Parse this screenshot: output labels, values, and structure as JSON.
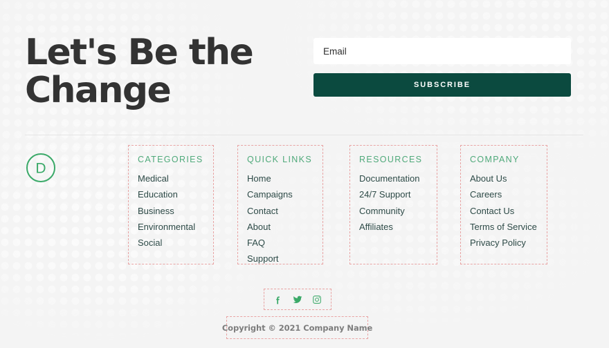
{
  "hero": {
    "heading": "Let's Be the\nChange"
  },
  "signup": {
    "email_placeholder": "Email",
    "email_value": "",
    "subscribe_label": "SUBSCRIBE"
  },
  "brand": {
    "logo_letter": "D",
    "logo_color": "#3aa968"
  },
  "theme": {
    "page_background": "#f4f4f4",
    "heading_color": "#333333",
    "button_background": "#0b4a3f",
    "button_text": "#ffffff",
    "column_title_color": "#4fa97a",
    "link_color": "#2d4a47",
    "wireframe_border": "#e8a3a3",
    "divider_color": "#e4e4e4",
    "copyright_color": "#7d7d7d"
  },
  "footer": {
    "columns": [
      {
        "title": "CATEGORIES",
        "links": [
          "Medical",
          "Education",
          "Business",
          "Environmental",
          "Social"
        ]
      },
      {
        "title": "QUICK LINKS",
        "links": [
          "Home",
          "Campaigns",
          "Contact",
          "About",
          "FAQ",
          "Support"
        ]
      },
      {
        "title": "RESOURCES",
        "links": [
          "Documentation",
          "24/7 Support",
          "Community",
          "Affiliates"
        ]
      },
      {
        "title": "COMPANY",
        "links": [
          "About Us",
          "Careers",
          "Contact Us",
          "Terms of Service",
          "Privacy Policy"
        ]
      }
    ],
    "social": [
      {
        "name": "facebook-icon",
        "label": "Facebook"
      },
      {
        "name": "twitter-icon",
        "label": "Twitter"
      },
      {
        "name": "instagram-icon",
        "label": "Instagram"
      }
    ],
    "copyright": "Copyright © 2021 Company Name"
  }
}
